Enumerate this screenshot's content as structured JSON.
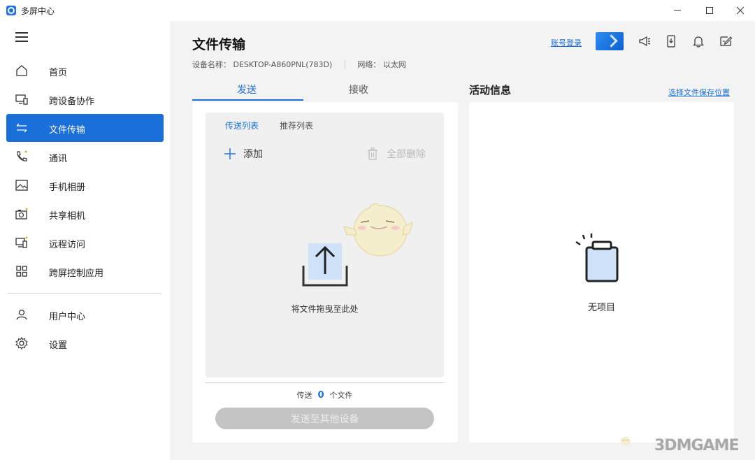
{
  "window": {
    "title": "多屏中心",
    "controls": {
      "minimize": "—",
      "maximize": "☐",
      "close": "✕"
    }
  },
  "sidebar": {
    "items": [
      {
        "label": "首页",
        "icon": "home-icon"
      },
      {
        "label": "跨设备协作",
        "icon": "cross-device-icon"
      },
      {
        "label": "文件传输",
        "icon": "transfer-arrows-icon",
        "active": true
      },
      {
        "label": "通讯",
        "icon": "phone-icon"
      },
      {
        "label": "手机相册",
        "icon": "gallery-icon"
      },
      {
        "label": "共享相机",
        "icon": "camera-icon"
      },
      {
        "label": "远程访问",
        "icon": "remote-access-icon"
      },
      {
        "label": "跨屏控制应用",
        "icon": "apps-grid-icon"
      },
      {
        "label": "用户中心",
        "icon": "user-icon"
      },
      {
        "label": "设置",
        "icon": "gear-icon"
      }
    ]
  },
  "header": {
    "title": "文件传输",
    "device_label": "设备名称：",
    "device_name": "DESKTOP-A860PNL(783D)",
    "network_label": "网络：",
    "network_value": "以太网",
    "login_link": "账号登录",
    "icons": [
      "flat-screen-icon",
      "megaphone-icon",
      "phone-download-icon",
      "bell-icon",
      "feedback-icon"
    ]
  },
  "tabs": {
    "send": "发送",
    "receive": "接收"
  },
  "send_panel": {
    "subtab_send_list": "传送列表",
    "subtab_recommend": "推荐列表",
    "add_label": "添加",
    "delete_all_label": "全部删除",
    "drop_hint": "将文件拖曳至此处",
    "count_prefix": "传送",
    "count_value": "0",
    "count_suffix": "个文件",
    "send_button": "发送至其他设备"
  },
  "activity": {
    "title": "活动信息",
    "choose_location": "选择文件保存位置",
    "empty_text": "无项目"
  },
  "watermark": {
    "text": "3DMGAME"
  },
  "colors": {
    "accent": "#1a6fd8",
    "sidebar_bg": "#ffffff",
    "content_bg": "#f3f3f3",
    "disabled_button": "#c4c4c4"
  }
}
